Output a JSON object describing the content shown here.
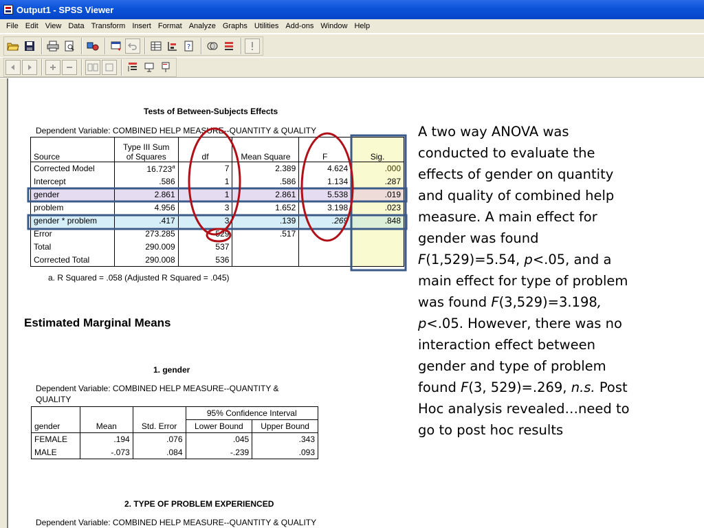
{
  "window": {
    "title": "Output1 - SPSS Viewer"
  },
  "menu": [
    "File",
    "Edit",
    "View",
    "Data",
    "Transform",
    "Insert",
    "Format",
    "Analyze",
    "Graphs",
    "Utilities",
    "Add-ons",
    "Window",
    "Help"
  ],
  "toolbar1_icons": [
    "open-icon",
    "save-icon",
    "print-icon",
    "print-preview-icon",
    "export-icon",
    "dialog-recall-icon",
    "undo-icon",
    "goto-data-icon",
    "goto-case-icon",
    "variables-icon",
    "use-sets-icon",
    "designate-window-icon",
    "run-icon"
  ],
  "toolbar2_icons": [
    "promote-icon",
    "demote-icon",
    "expand-icon",
    "collapse-icon",
    "show-icon",
    "hide-icon",
    "insert-heading-icon",
    "insert-title-icon",
    "insert-text-icon"
  ],
  "anova": {
    "title": "Tests of Between-Subjects Effects",
    "dependent_variable": "Dependent Variable: COMBINED HELP MEASURE--QUANTITY & QUALITY",
    "headers": [
      "Source",
      "Type III Sum of Squares",
      "df",
      "Mean Square",
      "F",
      "Sig."
    ],
    "header_ss_line1": "Type III Sum",
    "header_ss_line2": "of Squares",
    "rows": [
      {
        "source": "Corrected Model",
        "ss": "16.723",
        "ss_sup": "a",
        "df": "7",
        "ms": "2.389",
        "f": "4.624",
        "sig": ".000"
      },
      {
        "source": "Intercept",
        "ss": ".586",
        "df": "1",
        "ms": ".586",
        "f": "1.134",
        "sig": ".287"
      },
      {
        "source": "gender",
        "ss": "2.861",
        "df": "1",
        "ms": "2.861",
        "f": "5.538",
        "sig": ".019"
      },
      {
        "source": "problem",
        "ss": "4.956",
        "df": "3",
        "ms": "1.652",
        "f": "3.198",
        "sig": ".023"
      },
      {
        "source": "gender * problem",
        "ss": ".417",
        "df": "3",
        "ms": ".139",
        "f": ".269",
        "sig": ".848"
      },
      {
        "source": "Error",
        "ss": "273.285",
        "df": "529",
        "ms": ".517",
        "f": "",
        "sig": ""
      },
      {
        "source": "Total",
        "ss": "290.009",
        "df": "537",
        "ms": "",
        "f": "",
        "sig": ""
      },
      {
        "source": "Corrected Total",
        "ss": "290.008",
        "df": "536",
        "ms": "",
        "f": "",
        "sig": ""
      }
    ],
    "footnote": "a. R Squared = .058 (Adjusted R Squared = .045)"
  },
  "emm_heading": "Estimated Marginal Means",
  "gender_table": {
    "title": "1. gender",
    "dependent_variable_line1": "Dependent Variable: COMBINED HELP MEASURE--QUANTITY &",
    "dependent_variable_line2": "QUALITY",
    "ci_header": "95% Confidence Interval",
    "headers": [
      "gender",
      "Mean",
      "Std. Error",
      "Lower Bound",
      "Upper Bound"
    ],
    "rows": [
      {
        "gender": "FEMALE",
        "mean": ".194",
        "se": ".076",
        "lb": ".045",
        "ub": ".343"
      },
      {
        "gender": "MALE",
        "mean": "-.073",
        "se": ".084",
        "lb": "-.239",
        "ub": ".093"
      }
    ]
  },
  "problem_table": {
    "title": "2. TYPE OF PROBLEM EXPERIENCED",
    "dependent_variable": "Dependent Variable: COMBINED HELP MEASURE--QUANTITY & QUALITY"
  },
  "summary": {
    "s1": "A two way ANOVA was conducted to evaluate the effects of gender on quantity and quality of combined help measure. A main effect for gender was found ",
    "f1": "F",
    "s2": "(1,529)=5.54, ",
    "p1": "p",
    "s3": "<.05, and a main effect for type of problem was found ",
    "f2": "F",
    "s4": "(3,529)=3.198",
    "p2": ", p",
    "s5": "<.05. However, there was no interaction effect between gender and type of problem found ",
    "f3": "F",
    "s6": "(3, 529)=.269, ",
    "ns": "n.s.",
    "s7": " Post Hoc analysis revealed…need to go to post hoc results"
  },
  "colors": {
    "gender_row": "#e6dcf2",
    "interaction_row": "#d5eef8",
    "sig_col": "#fafad0",
    "highlight_border": "#3a5a8a",
    "circle": "#b01018"
  }
}
